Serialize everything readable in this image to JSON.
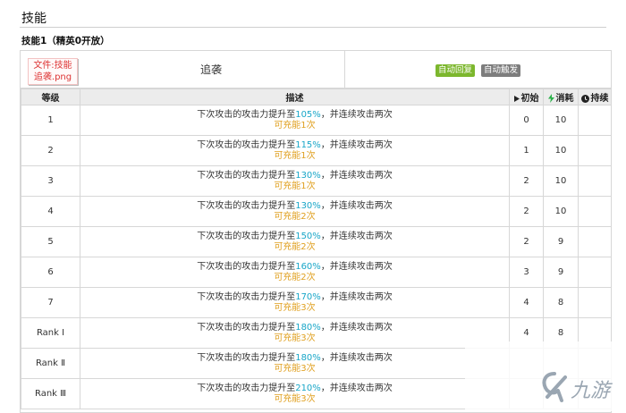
{
  "page": {
    "section_title": "技能",
    "skill_heading": "技能1（精英0开放）"
  },
  "skill": {
    "icon_text": "文件:技能 追袭.png",
    "name": "追袭",
    "badges": [
      "自动回复",
      "自动触发"
    ],
    "badge_colors": [
      "#7cb72d",
      "#7d7d7d"
    ]
  },
  "table": {
    "headers": {
      "level": "等级",
      "description": "描述",
      "initial": "初始",
      "cost": "消耗",
      "duration": "持续"
    },
    "header_icons": {
      "initial": "play-triangle-icon",
      "cost": "lightning-icon",
      "duration": "clock-icon"
    },
    "rows": [
      {
        "level": "1",
        "desc_prefix": "下次攻击的攻击力提升至",
        "percent": "105%",
        "desc_suffix": "，并连续攻击两次",
        "charges": "可充能1次",
        "initial": "0",
        "cost": "10",
        "duration": ""
      },
      {
        "level": "2",
        "desc_prefix": "下次攻击的攻击力提升至",
        "percent": "115%",
        "desc_suffix": "，并连续攻击两次",
        "charges": "可充能1次",
        "initial": "1",
        "cost": "10",
        "duration": ""
      },
      {
        "level": "3",
        "desc_prefix": "下次攻击的攻击力提升至",
        "percent": "130%",
        "desc_suffix": "，并连续攻击两次",
        "charges": "可充能1次",
        "initial": "2",
        "cost": "10",
        "duration": ""
      },
      {
        "level": "4",
        "desc_prefix": "下次攻击的攻击力提升至",
        "percent": "130%",
        "desc_suffix": "，并连续攻击两次",
        "charges": "可充能2次",
        "initial": "2",
        "cost": "10",
        "duration": ""
      },
      {
        "level": "5",
        "desc_prefix": "下次攻击的攻击力提升至",
        "percent": "150%",
        "desc_suffix": "，并连续攻击两次",
        "charges": "可充能2次",
        "initial": "2",
        "cost": "9",
        "duration": ""
      },
      {
        "level": "6",
        "desc_prefix": "下次攻击的攻击力提升至",
        "percent": "160%",
        "desc_suffix": "，并连续攻击两次",
        "charges": "可充能2次",
        "initial": "3",
        "cost": "9",
        "duration": ""
      },
      {
        "level": "7",
        "desc_prefix": "下次攻击的攻击力提升至",
        "percent": "170%",
        "desc_suffix": "，并连续攻击两次",
        "charges": "可充能3次",
        "initial": "4",
        "cost": "8",
        "duration": ""
      },
      {
        "level": "Rank Ⅰ",
        "desc_prefix": "下次攻击的攻击力提升至",
        "percent": "180%",
        "desc_suffix": "，并连续攻击两次",
        "charges": "可充能3次",
        "initial": "4",
        "cost": "8",
        "duration": ""
      },
      {
        "level": "Rank Ⅱ",
        "desc_prefix": "下次攻击的攻击力提升至",
        "percent": "180%",
        "desc_suffix": "，并连续攻击两次",
        "charges": "可充能3次",
        "initial": "",
        "cost": "",
        "duration": ""
      },
      {
        "level": "Rank Ⅲ",
        "desc_prefix": "下次攻击的攻击力提升至",
        "percent": "210%",
        "desc_suffix": "，并连续攻击两次",
        "charges": "可充能3次",
        "initial": "",
        "cost": "",
        "duration": ""
      }
    ]
  },
  "watermark": {
    "logo_text": "九游"
  }
}
